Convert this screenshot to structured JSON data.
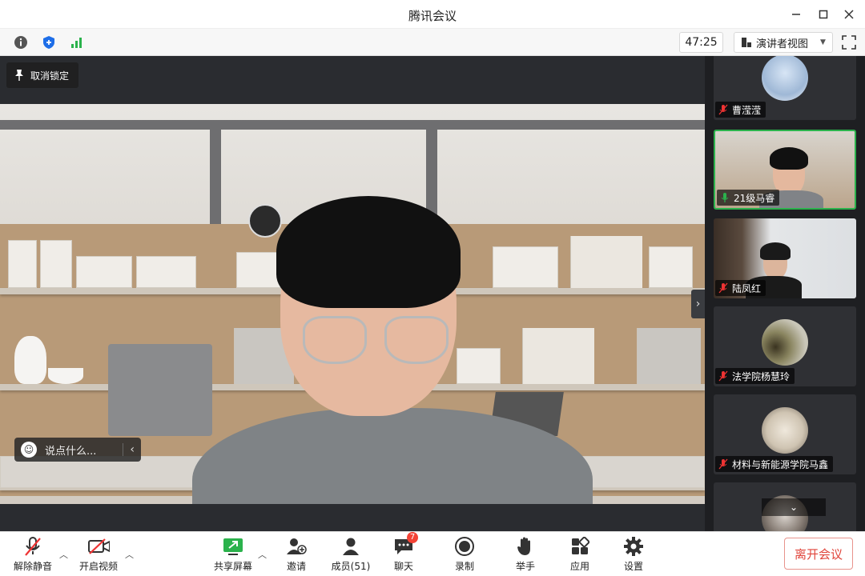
{
  "window": {
    "title": "腾讯会议"
  },
  "toolbar": {
    "timer": "47:25",
    "view_label": "演讲者视图"
  },
  "stage": {
    "unlock_label": "取消锁定",
    "chat_placeholder": "说点什么..."
  },
  "participants": [
    {
      "name": "曹滢滢",
      "mic": "off",
      "active": false
    },
    {
      "name": "21级马睿",
      "mic": "on",
      "active": true
    },
    {
      "name": "陆凤红",
      "mic": "off",
      "active": false
    },
    {
      "name": "法学院杨慧玲",
      "mic": "off",
      "active": false
    },
    {
      "name": "材料与新能源学院马鑫",
      "mic": "off",
      "active": false
    }
  ],
  "bottombar": {
    "unmute": "解除静音",
    "video": "开启视频",
    "share": "共享屏幕",
    "invite": "邀请",
    "members": "成员(51)",
    "chat": "聊天",
    "chat_badge": "7",
    "record": "录制",
    "raise_hand": "举手",
    "apps": "应用",
    "settings": "设置",
    "leave": "离开会议"
  },
  "colors": {
    "active_border": "#2bb24c",
    "leave_red": "#e0443a",
    "badge_red": "#f44336"
  }
}
